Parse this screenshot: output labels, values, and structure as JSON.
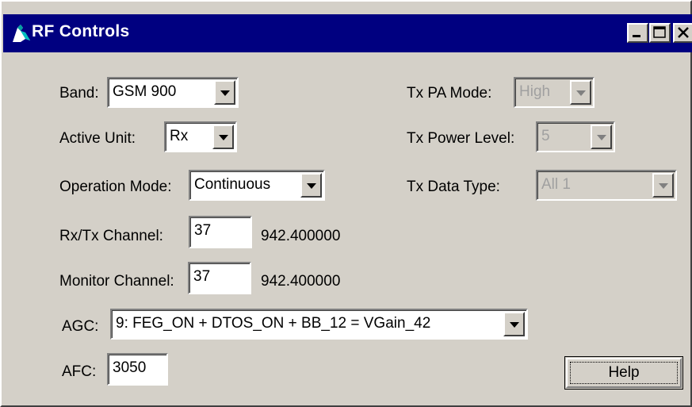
{
  "window": {
    "title": "RF Controls",
    "icon": "app-icon",
    "buttons": {
      "minimize": "minimize-icon",
      "maximize": "maximize-icon",
      "close": "close-icon"
    }
  },
  "left": {
    "band": {
      "label": "Band:",
      "value": "GSM 900"
    },
    "active_unit": {
      "label": "Active Unit:",
      "value": "Rx"
    },
    "operation_mode": {
      "label": "Operation Mode:",
      "value": "Continuous"
    },
    "rxtx_channel": {
      "label": "Rx/Tx Channel:",
      "value": "37",
      "frequency": "942.400000"
    },
    "monitor_channel": {
      "label": "Monitor Channel:",
      "value": "37",
      "frequency": "942.400000"
    },
    "agc": {
      "label": "AGC:",
      "value": "9: FEG_ON + DTOS_ON + BB_12 = VGain_42"
    },
    "afc": {
      "label": "AFC:",
      "value": "3050"
    }
  },
  "right": {
    "tx_pa_mode": {
      "label": "Tx PA Mode:",
      "value": "High",
      "enabled": false
    },
    "tx_power_level": {
      "label": "Tx Power Level:",
      "value": "5",
      "enabled": false
    },
    "tx_data_type": {
      "label": "Tx Data Type:",
      "value": "All 1",
      "enabled": false
    }
  },
  "help": {
    "label": "Help"
  }
}
